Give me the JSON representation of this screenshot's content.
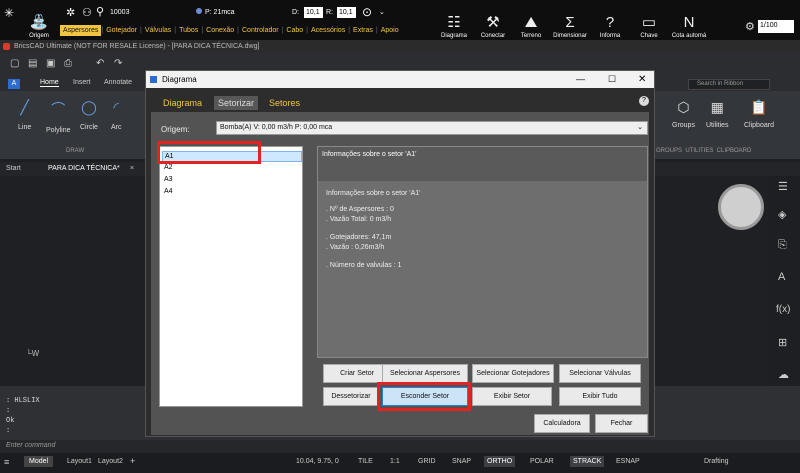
{
  "toolbar": {
    "origem_label": "Origem",
    "code_value": "10003",
    "pressure_value": "P: 21mca",
    "d_label": "D:",
    "d_value": "10,1",
    "r_label": "R:",
    "r_value": "10,1",
    "tabs": [
      "Aspersores",
      "Gotejador",
      "Válvulas",
      "Tubos",
      "Conexão",
      "Controlador",
      "Cabo",
      "Acessórios",
      "Extras",
      "Apoio"
    ],
    "right_buttons": [
      "Diagrama",
      "Conectar",
      "Terreno",
      "Dimensionar",
      "Informa",
      "Chave",
      "Cota automá"
    ],
    "zoom_value": "1/100"
  },
  "app_title": "BricsCAD Ultimate (NOT FOR RESALE License) - [PARA DICA TÉCNICA.dwg]",
  "ribbon": {
    "tabs": [
      "Home",
      "Insert",
      "Annotate"
    ],
    "draw_tools": [
      "Line",
      "Polyline",
      "Circle",
      "Arc"
    ],
    "draw_group": "DRAW",
    "search_placeholder": "Search in Ribbon",
    "right_tools": [
      "Groups",
      "Utilities",
      "Clipboard"
    ],
    "right_groups": "GROUPS  UTILITIES  CLIPBOARD"
  },
  "doc_tabs": [
    "Start",
    "PARA DICA TÉCNICA*"
  ],
  "command": {
    "line1": ": HLSLIX",
    "line2": ":",
    "line3": "Ok",
    "line4": ":",
    "prompt": "Enter command"
  },
  "status": {
    "tabs": [
      "Model",
      "Layout1",
      "Layout2"
    ],
    "coords": "10.04, 9.75, 0",
    "items": [
      "TILE",
      "1:1",
      "GRID",
      "SNAP",
      "ORTHO",
      "POLAR",
      "STRACK",
      "ESNAP",
      "Drafting"
    ]
  },
  "dialog": {
    "title": "Diagrama",
    "tabs": [
      "Diagrama",
      "Setorizar",
      "Setores"
    ],
    "origem_label": "Origem:",
    "origem_value": "Bomba(A) V: 0,00 m3/h P: 0,00 mca",
    "sectors": [
      "A1",
      "A2",
      "A3",
      "A4"
    ],
    "info_header": "Informações sobre o setor 'A1'",
    "info_lines": [
      "Informações sobre o setor 'A1'",
      "",
      ". Nº de Aspersores : 0",
      ". Vazão Total: 0 m3/h",
      "",
      ". Gotejadores: 47,1m",
      ". Vazão : 0,26m3/h",
      "",
      ". Número de valvulas :  1"
    ],
    "buttons_row1": [
      "Criar Setor",
      "Selecionar Aspersores",
      "Selecionar Gotejadores",
      "Selecionar Válvulas"
    ],
    "buttons_row2": [
      "Dessetorizar",
      "Esconder Setor",
      "Exibir Setor",
      "Exibir Tudo"
    ],
    "calc_label": "Calculadora",
    "close_label": "Fechar"
  }
}
